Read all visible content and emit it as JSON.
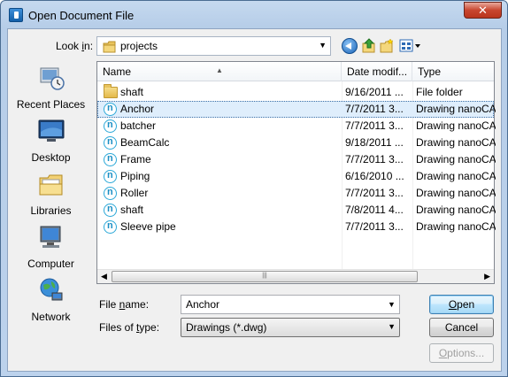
{
  "window": {
    "title": "Open Document File",
    "close_label": "✕"
  },
  "toolbar": {
    "lookin_label_pre": "Look ",
    "lookin_label_u": "i",
    "lookin_label_post": "n:",
    "lookin_value": "projects",
    "icons": [
      "back-icon",
      "up-folder-icon",
      "new-folder-icon",
      "views-menu-icon"
    ]
  },
  "places": [
    {
      "label": "Recent Places",
      "icon": "recent-places-icon"
    },
    {
      "label": "Desktop",
      "icon": "desktop-icon"
    },
    {
      "label": "Libraries",
      "icon": "libraries-icon"
    },
    {
      "label": "Computer",
      "icon": "computer-icon"
    },
    {
      "label": "Network",
      "icon": "network-icon"
    }
  ],
  "columns": {
    "name": "Name",
    "date": "Date modif...",
    "type": "Type"
  },
  "files": [
    {
      "name": "shaft",
      "date": "9/16/2011 ...",
      "type": "File folder",
      "icon": "folder-icon"
    },
    {
      "name": "Anchor",
      "date": "7/7/2011 3...",
      "type": "Drawing nanoCA...",
      "icon": "nanocad-file-icon",
      "selected": true
    },
    {
      "name": "batcher",
      "date": "7/7/2011 3...",
      "type": "Drawing nanoCA...",
      "icon": "nanocad-file-icon"
    },
    {
      "name": "BeamCalc",
      "date": "9/18/2011 ...",
      "type": "Drawing nanoCA...",
      "icon": "nanocad-file-icon"
    },
    {
      "name": "Frame",
      "date": "7/7/2011 3...",
      "type": "Drawing nanoCA...",
      "icon": "nanocad-file-icon"
    },
    {
      "name": "Piping",
      "date": "6/16/2010 ...",
      "type": "Drawing nanoCA...",
      "icon": "nanocad-file-icon"
    },
    {
      "name": "Roller",
      "date": "7/7/2011 3...",
      "type": "Drawing nanoCA...",
      "icon": "nanocad-file-icon"
    },
    {
      "name": "shaft",
      "date": "7/8/2011 4...",
      "type": "Drawing nanoCA...",
      "icon": "nanocad-file-icon"
    },
    {
      "name": "Sleeve pipe",
      "date": "7/7/2011 3...",
      "type": "Drawing nanoCA...",
      "icon": "nanocad-file-icon"
    }
  ],
  "form": {
    "filename_label_pre": "File ",
    "filename_label_u": "n",
    "filename_label_post": "ame:",
    "filename_value": "Anchor",
    "filetype_label_pre": "Files of ",
    "filetype_label_u": "t",
    "filetype_label_post": "ype:",
    "filetype_value": "Drawings (*.dwg)"
  },
  "buttons": {
    "open_u": "O",
    "open_rest": "pen",
    "cancel": "Cancel",
    "options_u": "O",
    "options_rest": "ptions..."
  },
  "colors": {
    "accent": "#3c7fb1",
    "selection": "#dfeefc",
    "nanocad_icon": "#2aa8d8",
    "close_red": "#c8462f"
  }
}
